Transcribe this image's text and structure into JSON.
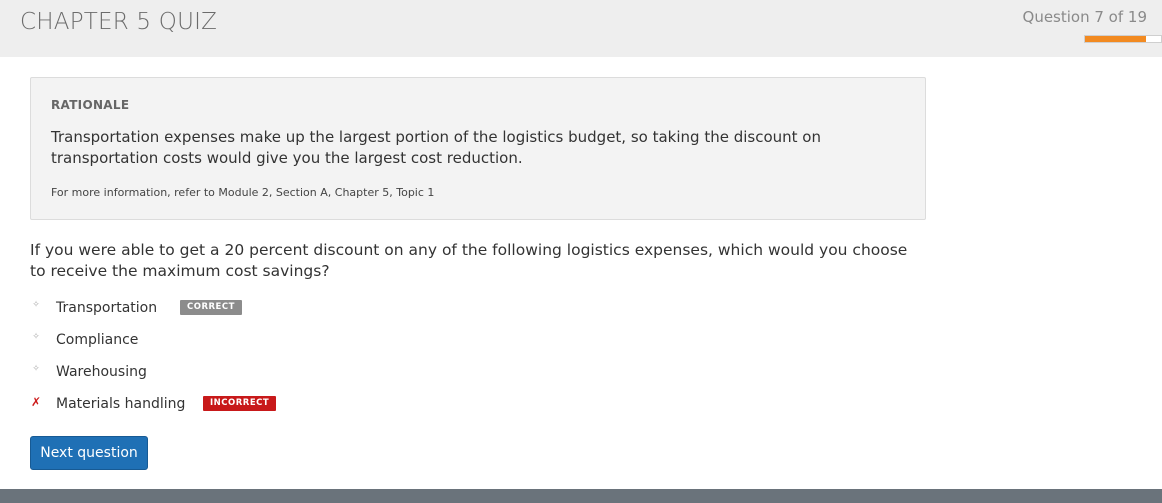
{
  "header": {
    "title": "CHAPTER 5 QUIZ",
    "question_counter": "Question 7 of 19",
    "progress": {
      "current": 7,
      "total": 19,
      "fraction": 0.8,
      "color": "#f28a21"
    }
  },
  "rationale": {
    "heading": "RATIONALE",
    "body": "Transportation expenses make up the largest portion of the logistics budget, so taking the discount on transportation costs would give you the largest cost reduction.",
    "reference": "For more information, refer to Module 2, Section A, Chapter 5, Topic 1"
  },
  "question": {
    "text": "If you were able to get a 20 percent discount on any of the following logistics expenses, which would you choose to receive the maximum cost savings?"
  },
  "answers": [
    {
      "label": "Transportation",
      "marker": "✧",
      "badge": "CORRECT"
    },
    {
      "label": "Compliance",
      "marker": "✧",
      "badge": ""
    },
    {
      "label": "Warehousing",
      "marker": "✧",
      "badge": ""
    },
    {
      "label": "Materials handling",
      "marker": "✗",
      "badge": "INCORRECT"
    }
  ],
  "actions": {
    "next_label": "Next question"
  },
  "colors": {
    "accent": "#1f70b5",
    "correct_badge": "#8c8c8c",
    "incorrect_badge": "#c8191a"
  }
}
